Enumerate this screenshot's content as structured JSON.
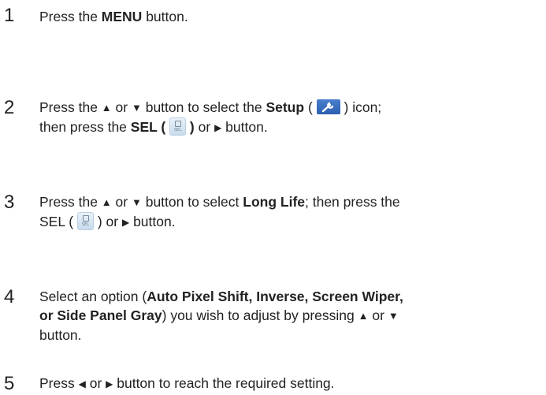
{
  "steps": [
    {
      "number": "1",
      "pre": "Press the ",
      "bold": "MENU",
      "post": " button."
    },
    {
      "number": "2",
      "a": "Press the ",
      "b": " or ",
      "c": " button to select the ",
      "d": "Setup",
      "e": " ( ",
      "f": " ) icon;",
      "g": "then press the ",
      "h": "SEL ( ",
      "i": " )",
      "j": " or ",
      "k": " button."
    },
    {
      "number": "3",
      "a": "Press the ",
      "b": " or ",
      "c": " button to select ",
      "d": "Long Life",
      "e": "; then press the",
      "f": "SEL ( ",
      "g": " ) or ",
      "h": " button."
    },
    {
      "number": "4",
      "a": "Select an option (",
      "b": "Auto Pixel Shift, Inverse, Screen Wiper,",
      "c": "or Side Panel Gray",
      "d": ") you wish to adjust by pressing ",
      "e": " or ",
      "f": "button."
    },
    {
      "number": "5",
      "a": "Press ",
      "b": " or ",
      "c": " button to reach the required setting."
    }
  ],
  "icons": {
    "sel_label": "SEL"
  }
}
